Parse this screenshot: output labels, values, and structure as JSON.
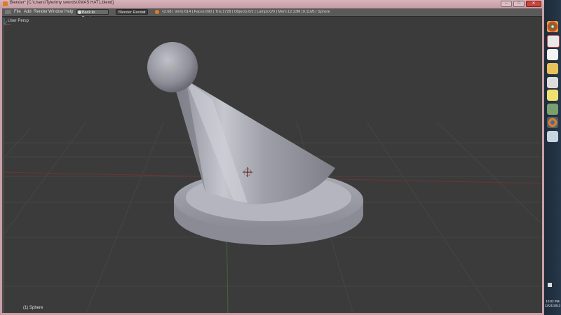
{
  "window": {
    "title": "Blender* [C:\\Users\\Tyler\\my swords\\XMAS HAT1.blend]",
    "controls": {
      "minimize": "–",
      "maximize": "□",
      "close": "✕"
    }
  },
  "menubar": {
    "items": [
      "File",
      "Add",
      "Render",
      "Window",
      "Help"
    ],
    "back_button": "Back to Previous",
    "render_engine": "Blender Render",
    "stats": "v2.68 | Verts:614 | Faces:690 | Tris:1728 | Objects:0/1 | Lamps:0/0 | Mem:12.33M (0.11M) | Sphere"
  },
  "viewport": {
    "view_label": "User Persp",
    "object_label": "(1) Sphere",
    "background_color": "#3b3b3b",
    "grid_color": "#444444",
    "x_axis_color": "#7a3a3a",
    "y_axis_color": "#4a7a3a"
  },
  "taskbar": {
    "icons": [
      "chrome-icon",
      "red-app-icon",
      "calendar-icon",
      "folder-icon",
      "pen-icon",
      "notes-icon",
      "microphone-icon",
      "blender-icon",
      "browser-icon"
    ],
    "time": "10:02 PM",
    "date": "12/21/2013"
  }
}
